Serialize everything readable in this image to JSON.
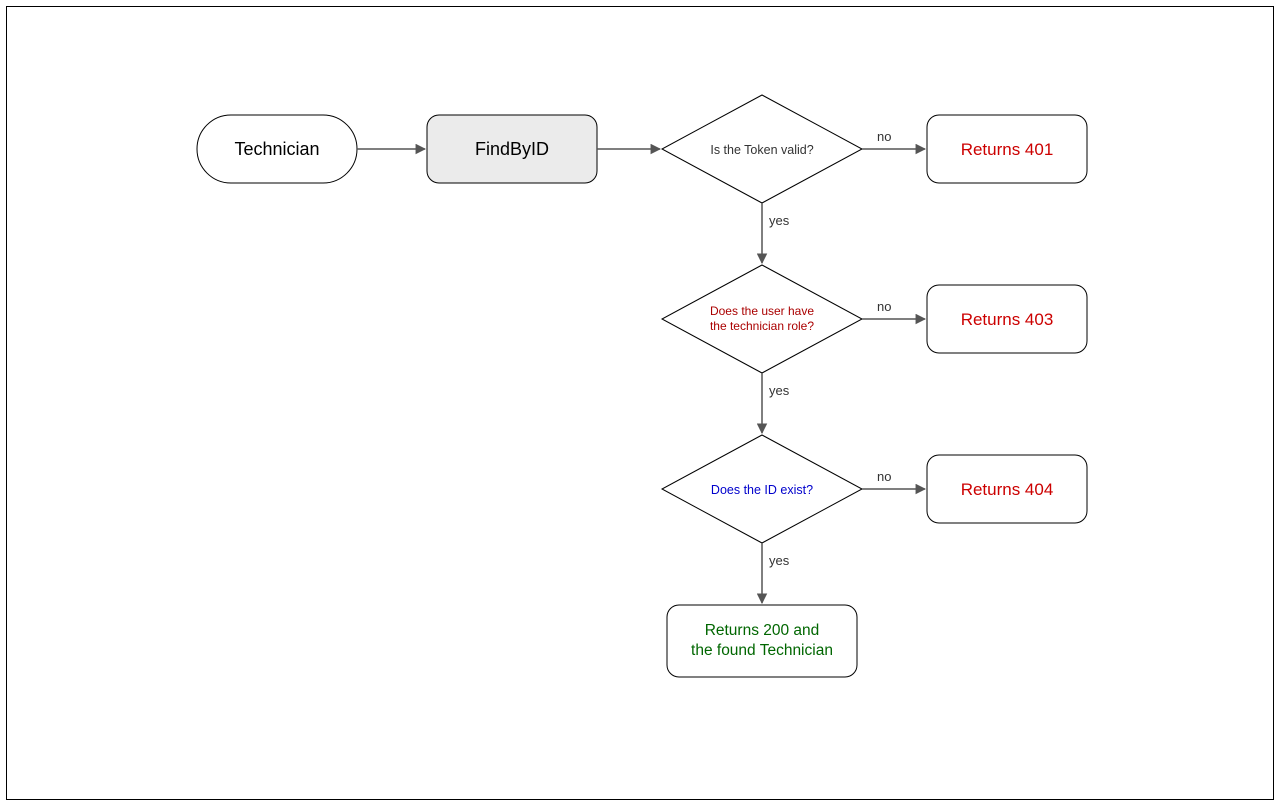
{
  "nodes": {
    "start": "Technician",
    "process": "FindByID",
    "decision1": "Is the Token valid?",
    "decision2_line1": "Does the user have",
    "decision2_line2": "the technician role?",
    "decision3": "Does the ID exist?",
    "result401": "Returns 401",
    "result403": "Returns 403",
    "result404": "Returns 404",
    "result200_line1": "Returns 200 and",
    "result200_line2": "the found Technician"
  },
  "edges": {
    "yes": "yes",
    "no": "no"
  },
  "colors": {
    "red": "#cc0000",
    "darkred": "#aa0000",
    "blue": "#0000cc",
    "green": "#006600",
    "gray": "#555555",
    "fillGray": "#ebebeb"
  }
}
